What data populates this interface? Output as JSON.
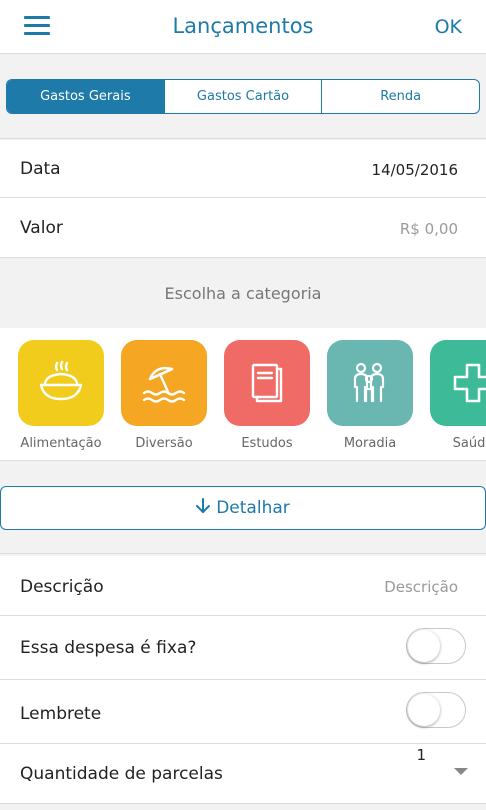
{
  "header": {
    "title": "Lançamentos",
    "ok_label": "OK",
    "menu_icon": "hamburger-menu-icon"
  },
  "tabs": [
    {
      "label": "Gastos Gerais",
      "active": true
    },
    {
      "label": "Gastos Cartão",
      "active": false
    },
    {
      "label": "Renda",
      "active": false
    }
  ],
  "form": {
    "date_label": "Data",
    "date_value": "14/05/2016",
    "amount_label": "Valor",
    "amount_placeholder": "R$ 0,00"
  },
  "categories": {
    "title": "Escolha a categoria",
    "items": [
      {
        "label": "Alimentação",
        "color": "#f2cc1c",
        "icon": "food-bowl-icon"
      },
      {
        "label": "Diversão",
        "color": "#f5a623",
        "icon": "beach-umbrella-icon"
      },
      {
        "label": "Estudos",
        "color": "#f06b66",
        "icon": "book-icon"
      },
      {
        "label": "Moradia",
        "color": "#6ab6b1",
        "icon": "family-icon"
      },
      {
        "label": "Saúde",
        "color": "#3dba97",
        "icon": "health-cross-icon"
      }
    ]
  },
  "detail_button": {
    "label": "Detalhar",
    "icon": "arrow-down-icon"
  },
  "details": {
    "description_label": "Descrição",
    "description_placeholder": "Descrição",
    "fixed_expense_label": "Essa despesa é fixa?",
    "fixed_expense_on": false,
    "reminder_label": "Lembrete",
    "reminder_on": false,
    "installments_label": "Quantidade de parcelas",
    "installments_value": "1"
  },
  "colors": {
    "accent": "#1e7aa8",
    "background": "#f2f2f2"
  }
}
